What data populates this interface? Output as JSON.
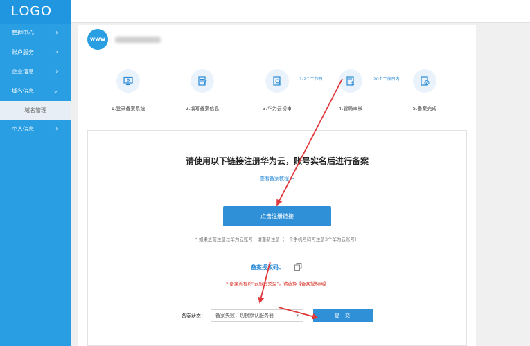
{
  "logo": "LOGO",
  "sidebar": {
    "items": [
      {
        "label": "管理中心"
      },
      {
        "label": "账户服务"
      },
      {
        "label": "企业信息"
      },
      {
        "label": "域名信息"
      },
      {
        "label": "域名管理"
      },
      {
        "label": "个人信息"
      }
    ]
  },
  "domain": {
    "badge": "www"
  },
  "steps": [
    {
      "label": "1.登录备案系统",
      "icon": "monitor-icon"
    },
    {
      "label": "2.填写备案信息",
      "icon": "edit-document-icon"
    },
    {
      "label": "3.华为云初审",
      "icon": "search-document-icon"
    },
    {
      "label": "4.管局审核",
      "icon": "user-document-icon"
    },
    {
      "label": "5.备案完成",
      "icon": "check-document-icon"
    }
  ],
  "step_times": [
    "1-2个工作日",
    "20个工作日内"
  ],
  "content": {
    "headline": "请使用以下链接注册华为云，账号实名后进行备案",
    "tutorial_link": "查看备案教程 >",
    "register_button": "点击注册链接",
    "note": "* 如果之前注册过华为云账号，请重新注册（一个手机号码可注册3个华为云账号）",
    "auth_code_label": "备案授权码：",
    "warning": "* 备案流程的\"云服务类型\"，请选择【备案授权码】",
    "status_label": "备案状态：",
    "status_value": "备案失败，切换默认服务器",
    "submit_button": "提 交"
  },
  "colors": {
    "sidebar": "#2a9ee3",
    "primary_button": "#2f90d7",
    "arrow": "#e0393c",
    "warning": "#d9342a"
  }
}
